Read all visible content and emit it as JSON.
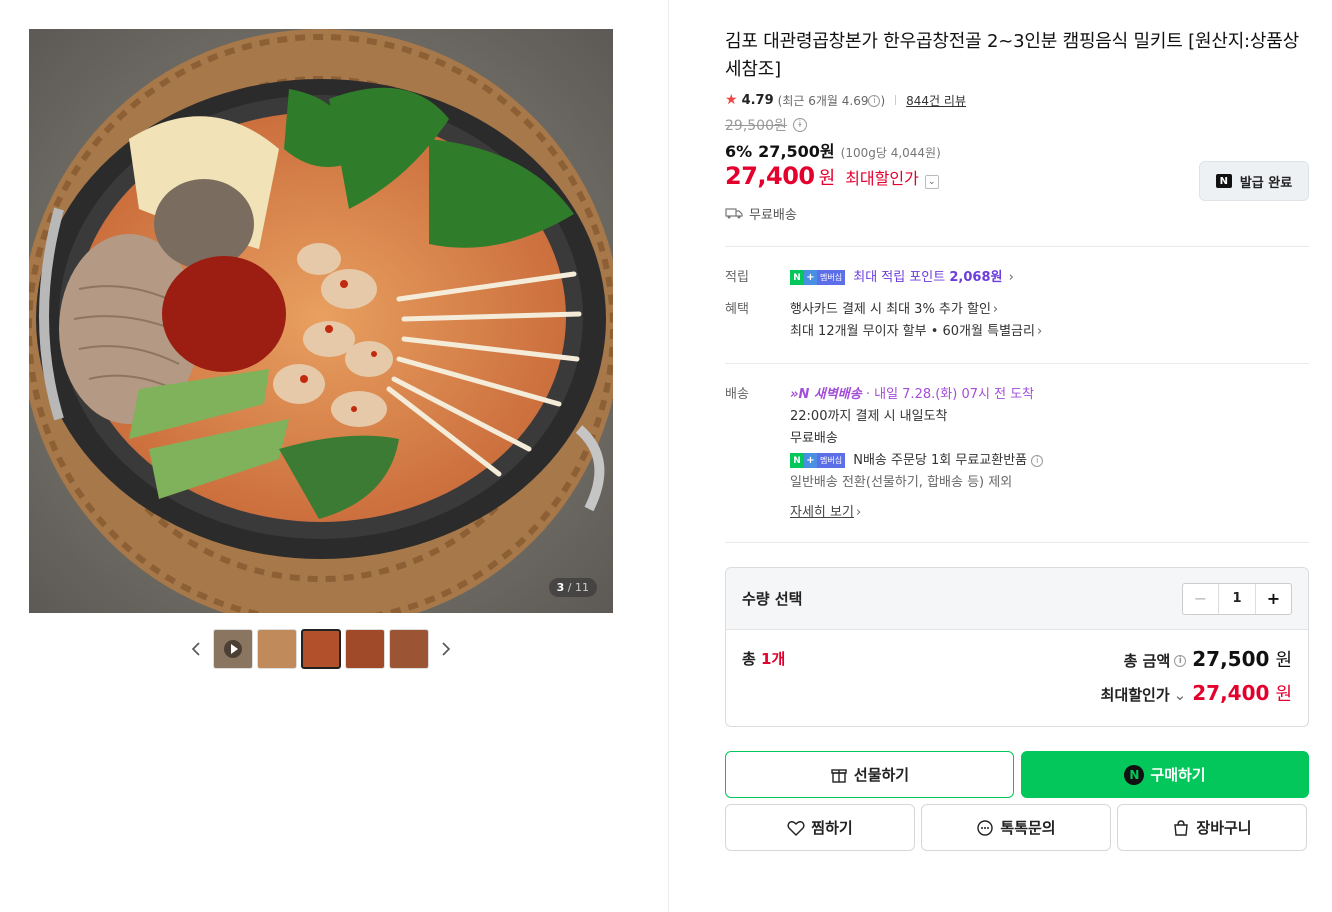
{
  "gallery": {
    "counter_current": "3",
    "counter_total": "11",
    "counter_sep": "/",
    "thumbnail_count": 5,
    "active_thumbnail": 3
  },
  "product": {
    "title": "김포 대관령곱창본가 한우곱창전골 2~3인분 캠핑음식 밀키트 [원산지:상품상세참조]",
    "rating": "4.79",
    "recent_rating": "(최근 6개월 4.69",
    "recent_rating_close": ")",
    "review_count": "844건 리뷰",
    "original_price": "29,500원",
    "discount_pct": "6%",
    "sale_price": "27,500원",
    "unit_price": "(100g당 4,044원)",
    "max_price": "27,400",
    "max_won": "원",
    "max_label": "최대할인가",
    "coupon_button": "발급 완료",
    "shipping_free": "무료배송"
  },
  "benefits": {
    "points_label": "적립",
    "points_text": "최대 적립 포인트",
    "points_value": "2,068원",
    "benefit_label": "혜택",
    "benefit_card": "행사카드 결제 시 최대 3% 추가 할인",
    "benefit_installment": "최대 12개월 무이자 할부 • 60개월 특별금리",
    "membership_badge": "멤버십"
  },
  "delivery": {
    "label": "배송",
    "dawn_name": "새벽배송",
    "dawn_arrival": "· 내일 7.28.(화) 07시 전 도착",
    "cutoff": "22:00까지 결제 시 내일도착",
    "free": "무료배송",
    "nexchange": "N배송 주문당 1회 무료교환반품",
    "exception": "일반배송 전환(선물하기, 합배송 등) 제외",
    "detail_link": "자세히 보기"
  },
  "quantity": {
    "title": "수량 선택",
    "value": "1",
    "minus": "−",
    "plus": "+",
    "total_prefix": "총 ",
    "total_count": "1개",
    "total_label": "총 금액",
    "total_value": "27,500",
    "won": "원",
    "max_label": "최대할인가",
    "max_value": "27,400"
  },
  "actions": {
    "gift": "선물하기",
    "buy": "구매하기",
    "wish": "찜하기",
    "talk": "톡톡문의",
    "cart": "장바구니"
  },
  "colors": {
    "accent_green": "#03c75a",
    "price_red": "#e3002d",
    "point_purple": "#6b3ddb",
    "dawn_purple": "#a34ed9"
  }
}
